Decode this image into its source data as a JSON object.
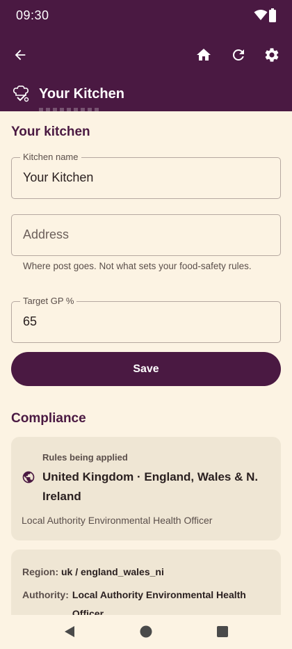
{
  "status_bar": {
    "time": "09:30"
  },
  "app_bar": {
    "title": "Your Kitchen"
  },
  "kitchen_section": {
    "heading": "Your kitchen",
    "kitchen_name": {
      "label": "Kitchen name",
      "value": "Your Kitchen"
    },
    "address": {
      "placeholder": "Address",
      "helper": "Where post goes. Not what sets your food-safety rules."
    },
    "target_gp": {
      "label": "Target GP %",
      "value": "65"
    },
    "save_label": "Save"
  },
  "compliance_section": {
    "heading": "Compliance",
    "rules_label": "Rules being applied",
    "rules_value": "United Kingdom · England, Wales & N. Ireland",
    "rules_authority": "Local Authority Environmental Health Officer",
    "details": {
      "region_key": "Region:",
      "region_value": "uk / england_wales_ni",
      "authority_key": "Authority:",
      "authority_value": "Local Authority Environmental Health Officer"
    }
  },
  "icons": {
    "back": "arrow-left-icon",
    "home": "home-icon",
    "refresh": "refresh-icon",
    "settings": "gear-icon",
    "logo": "chef-hat-check-icon",
    "globe": "globe-icon"
  },
  "colors": {
    "primary": "#4a1942",
    "background": "#fcf3e3",
    "card": "#efe6d4"
  }
}
